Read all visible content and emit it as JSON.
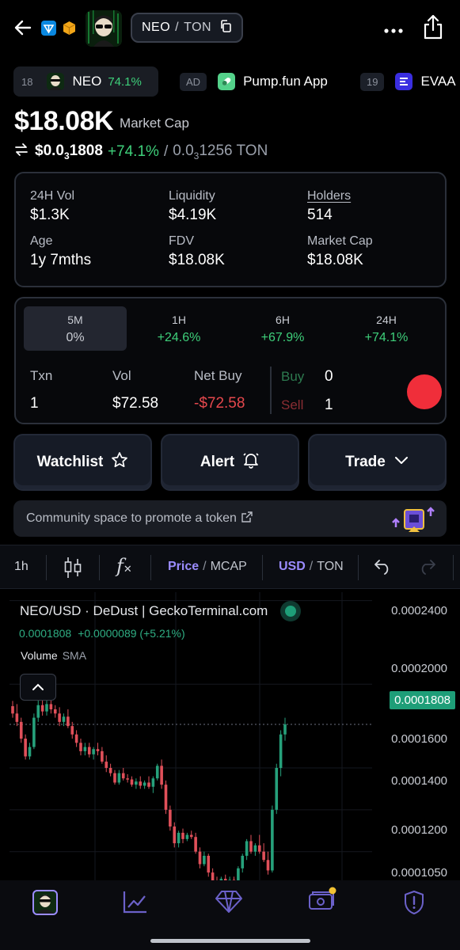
{
  "header": {
    "pair_base": "NEO",
    "pair_sep": "/",
    "pair_quote": "TON",
    "icons": [
      "back-arrow-icon",
      "ton-chain-icon",
      "cube-icon",
      "token-avatar",
      "copy-icon",
      "more-icon",
      "share-icon"
    ]
  },
  "ticker": [
    {
      "rank": "18",
      "name": "NEO",
      "change": "74.1%"
    },
    {
      "rank": "AD",
      "name": "Pump.fun App",
      "change": ""
    },
    {
      "rank": "19",
      "name": "EVAA",
      "change": ""
    }
  ],
  "market": {
    "market_cap_value": "$18.08K",
    "market_cap_label": "Market Cap",
    "price_prefix": "$0.0",
    "price_sub": "3",
    "price_rest": "1808",
    "price_change": "+74.1%",
    "ton_sep": "/",
    "ton_prefix": "0.0",
    "ton_sub": "3",
    "ton_rest": "1256 TON"
  },
  "stats": [
    {
      "label": "24H Vol",
      "value": "$1.3K"
    },
    {
      "label": "Liquidity",
      "value": "$4.19K"
    },
    {
      "label": "Holders",
      "value": "514"
    },
    {
      "label": "Age",
      "value": "1y 7mths"
    },
    {
      "label": "FDV",
      "value": "$18.08K"
    },
    {
      "label": "Market Cap",
      "value": "$18.08K"
    }
  ],
  "timeframes": [
    {
      "label": "5M",
      "value": "0%",
      "selected": true
    },
    {
      "label": "1H",
      "value": "+24.6%"
    },
    {
      "label": "6H",
      "value": "+67.9%"
    },
    {
      "label": "24H",
      "value": "+74.1%"
    }
  ],
  "txn": {
    "txn_label": "Txn",
    "txn_value": "1",
    "vol_label": "Vol",
    "vol_value": "$72.58",
    "net_label": "Net Buy",
    "net_value": "-$72.58",
    "buy_label": "Buy",
    "buy_value": "0",
    "sell_label": "Sell",
    "sell_value": "1"
  },
  "actions": {
    "watchlist": "Watchlist",
    "alert": "Alert",
    "trade": "Trade"
  },
  "promo": {
    "text": "Community space to promote a token"
  },
  "toolbar": {
    "interval": "1h",
    "fx": "f",
    "price": "Price",
    "sep1": "/",
    "mcap": "MCAP",
    "usd": "USD",
    "sep2": "/",
    "ton": "TON"
  },
  "chart_data": {
    "type": "candlestick",
    "title": "NEO/USD · DeDust | GeckoTerminal.com",
    "last_price": "0.0001808",
    "change_text": "+0.0000089 (+5.21%)",
    "indicator_label": "Volume",
    "indicator_sub": "SMA",
    "y_ticks": [
      "0.0002400",
      "0.0002000",
      "0.0001600",
      "0.0001400",
      "0.0001200",
      "0.0001050"
    ],
    "ylim": [
      0.000104,
      0.000244
    ],
    "up_color": "#26a17b",
    "down_color": "#e0505a",
    "candles": [
      [
        0.0001895,
        0.000192,
        0.000184,
        0.000186
      ],
      [
        0.000186,
        0.0001905,
        0.00018,
        0.000182
      ],
      [
        0.000182,
        0.000184,
        0.000172,
        0.000174
      ],
      [
        0.000174,
        0.000176,
        0.000164,
        0.0001655
      ],
      [
        0.0001655,
        0.000172,
        0.000164,
        0.00017
      ],
      [
        0.00017,
        0.000186,
        0.000169,
        0.000184
      ],
      [
        0.000184,
        0.000194,
        0.000182,
        0.00019
      ],
      [
        0.00019,
        0.000193,
        0.000185,
        0.000187
      ],
      [
        0.000187,
        0.0001925,
        0.000185,
        0.0001905
      ],
      [
        0.0001905,
        0.000193,
        0.000186,
        0.000188
      ],
      [
        0.000188,
        0.00019,
        0.000184,
        0.000186
      ],
      [
        0.000186,
        0.000189,
        0.00018,
        0.000182
      ],
      [
        0.000182,
        0.000186,
        0.00018,
        0.0001845
      ],
      [
        0.0001845,
        0.000188,
        0.000179,
        0.00018
      ],
      [
        0.00018,
        0.000182,
        0.000174,
        0.000176
      ],
      [
        0.000176,
        0.000178,
        0.00017,
        0.000172
      ],
      [
        0.000172,
        0.000174,
        0.000166,
        0.000168
      ],
      [
        0.000168,
        0.000172,
        0.000166,
        0.00017
      ],
      [
        0.00017,
        0.000172,
        0.000165,
        0.0001665
      ],
      [
        0.0001665,
        0.00017,
        0.000164,
        0.000169
      ],
      [
        0.000169,
        0.000172,
        0.000166,
        0.000168
      ],
      [
        0.000168,
        0.00017,
        0.000162,
        0.000163
      ],
      [
        0.000163,
        0.000166,
        0.000158,
        0.00016
      ],
      [
        0.00016,
        0.000162,
        0.000156,
        0.0001575
      ],
      [
        0.0001575,
        0.000159,
        0.000152,
        0.000153
      ],
      [
        0.000153,
        0.000159,
        0.000152,
        0.0001575
      ],
      [
        0.0001575,
        0.00016,
        0.000154,
        0.000155
      ],
      [
        0.000155,
        0.000157,
        0.000153,
        0.0001545
      ],
      [
        0.0001545,
        0.000156,
        0.000151,
        0.000152
      ],
      [
        0.000152,
        0.000155,
        0.00015,
        0.0001535
      ],
      [
        0.0001535,
        0.000156,
        0.00015,
        0.0001515
      ],
      [
        0.0001515,
        0.000154,
        0.00015,
        0.000153
      ],
      [
        0.000153,
        0.000156,
        0.00015,
        0.000151
      ],
      [
        0.000151,
        0.000156,
        0.000148,
        0.000155
      ],
      [
        0.000155,
        0.000162,
        0.000154,
        0.000161
      ],
      [
        0.000161,
        0.000164,
        0.00015,
        0.000152
      ],
      [
        0.000152,
        0.000154,
        0.000138,
        0.00014
      ],
      [
        0.00014,
        0.000142,
        0.00013,
        0.000132
      ],
      [
        0.000132,
        0.000134,
        0.000122,
        0.000124
      ],
      [
        0.000124,
        0.00013,
        0.000122,
        0.000129
      ],
      [
        0.000129,
        0.000131,
        0.000124,
        0.000126
      ],
      [
        0.000126,
        0.000129,
        0.000125,
        0.000128
      ],
      [
        0.000128,
        0.00013,
        0.000126,
        0.000127
      ],
      [
        0.000127,
        0.000129,
        0.000119,
        0.00012
      ],
      [
        0.00012,
        0.000122,
        0.000112,
        0.000114
      ],
      [
        0.000114,
        0.00012,
        0.000113,
        0.000118
      ],
      [
        0.000118,
        0.000119,
        0.000108,
        0.00011
      ],
      [
        0.00011,
        0.000112,
        0.000105,
        0.000106
      ],
      [
        0.000106,
        0.000108,
        0.000104,
        0.000105
      ],
      [
        0.000105,
        0.000108,
        0.0001045,
        0.000107
      ],
      [
        0.000107,
        0.000109,
        0.000105,
        0.000106
      ],
      [
        0.000106,
        0.000108,
        0.000105,
        0.0001065
      ],
      [
        0.0001065,
        0.000108,
        0.000105,
        0.000106
      ],
      [
        0.000106,
        0.000113,
        0.000105,
        0.000112
      ],
      [
        0.000112,
        0.000119,
        0.00011,
        0.000118
      ],
      [
        0.000118,
        0.000126,
        0.000116,
        0.000125
      ],
      [
        0.000125,
        0.000128,
        0.000119,
        0.00012
      ],
      [
        0.00012,
        0.000124,
        0.000118,
        0.000123
      ],
      [
        0.000123,
        0.000128,
        0.000119,
        0.00012
      ],
      [
        0.00012,
        0.000124,
        0.000115,
        0.000116
      ],
      [
        0.000116,
        0.00012,
        0.000109,
        0.000111
      ],
      [
        0.000111,
        0.000142,
        0.00011,
        0.00014
      ],
      [
        0.00014,
        0.000162,
        0.000138,
        0.00016
      ],
      [
        0.00016,
        0.000178,
        0.000156,
        0.000176
      ],
      [
        0.000176,
        0.000184,
        0.000173,
        0.0001808
      ]
    ]
  },
  "nav": [
    "token-avatar-tab",
    "chart-tab",
    "diamond-tab",
    "wallet-tab",
    "shield-tab"
  ]
}
